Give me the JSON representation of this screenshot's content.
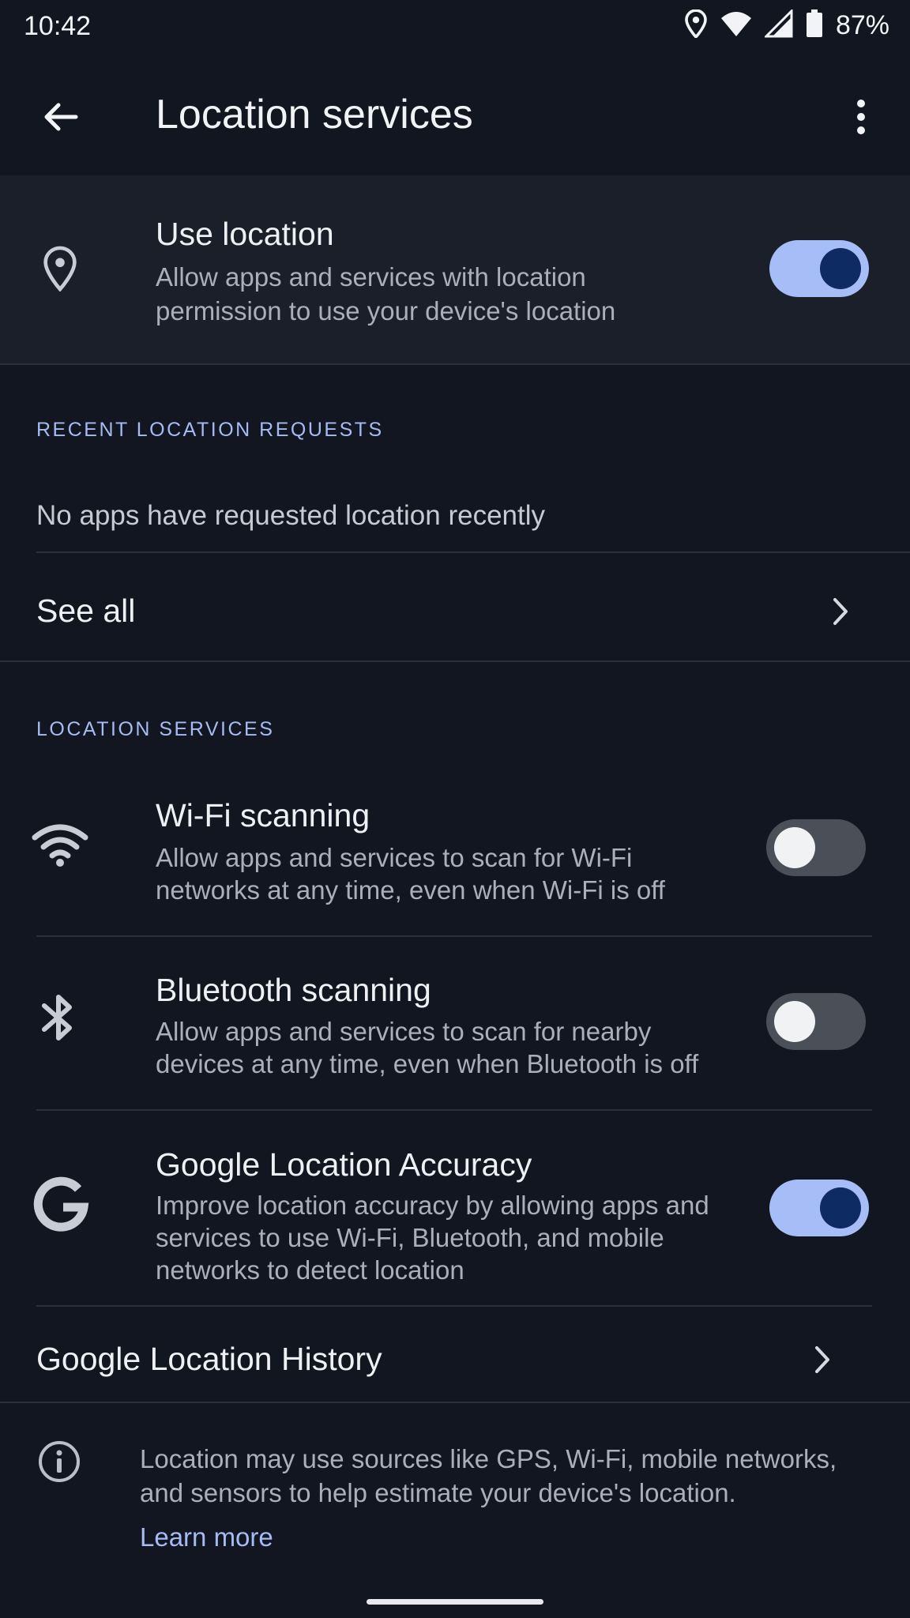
{
  "status_bar": {
    "time": "10:42",
    "battery_percent": "87%",
    "icons": [
      "location-icon",
      "wifi-icon",
      "signal-icon",
      "battery-icon"
    ]
  },
  "app_bar": {
    "title": "Location services",
    "back_icon": "arrow-back-icon",
    "more_icon": "more-vert-icon"
  },
  "use_location": {
    "title": "Use location",
    "subtitle_line1": "Allow apps and services with location",
    "subtitle_line2": "permission to use your device's location",
    "enabled": true,
    "icon": "location-pin-icon"
  },
  "recent_requests": {
    "header": "RECENT LOCATION REQUESTS",
    "empty_text": "No apps have requested location recently",
    "see_all_label": "See all"
  },
  "location_services": {
    "header": "LOCATION SERVICES",
    "items": [
      {
        "title": "Wi-Fi scanning",
        "subtitle_line1": "Allow apps and services to scan for Wi-Fi",
        "subtitle_line2": "networks at any time, even when Wi-Fi is off",
        "enabled": false,
        "icon": "wifi-icon"
      },
      {
        "title": "Bluetooth scanning",
        "subtitle_line1": "Allow apps and services to scan for nearby",
        "subtitle_line2": "devices at any time, even when Bluetooth is off",
        "enabled": false,
        "icon": "bluetooth-icon"
      },
      {
        "title": "Google Location Accuracy",
        "subtitle_line1": "Improve location accuracy by allowing apps and",
        "subtitle_line2": "services to use Wi-Fi, Bluetooth, and mobile",
        "subtitle_line3": "networks to detect location",
        "enabled": true,
        "icon": "google-icon"
      }
    ],
    "history_label": "Google Location History"
  },
  "footer": {
    "info_line1": "Location may use sources like GPS, Wi-Fi, mobile networks,",
    "info_line2": "and sensors to help estimate your device's location.",
    "learn_more": "Learn more",
    "icon": "info-icon"
  },
  "colors": {
    "background": "#121620",
    "card": "#1a1f2a",
    "accent": "#a6bbf2",
    "toggle_on_track": "#a7bdf7",
    "toggle_on_knob": "#0f2b63",
    "toggle_off_track": "#4b4f58"
  }
}
